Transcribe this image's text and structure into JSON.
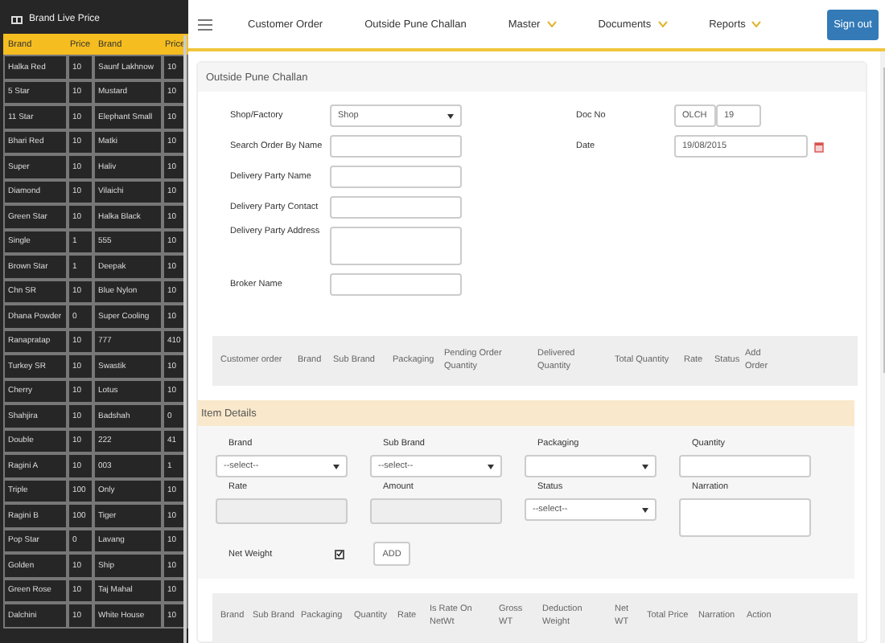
{
  "sidebar": {
    "title": "Brand Live Price",
    "columns": [
      "Brand",
      "Price",
      "Brand",
      "Price"
    ],
    "rows": [
      [
        "Halka Red",
        "10",
        "Saunf Lakhnow",
        "10"
      ],
      [
        "5 Star",
        "10",
        "Mustard",
        "10"
      ],
      [
        "11 Star",
        "10",
        "Elephant Small",
        "10"
      ],
      [
        "Bhari Red",
        "10",
        "Matki",
        "10"
      ],
      [
        "Super",
        "10",
        "Haliv",
        "10"
      ],
      [
        "Diamond",
        "10",
        "Vilaichi",
        "10"
      ],
      [
        "Green Star",
        "10",
        "Halka Black",
        "10"
      ],
      [
        "Single",
        "1",
        "555",
        "10"
      ],
      [
        "Brown Star",
        "1",
        "Deepak",
        "10"
      ],
      [
        "Chn SR",
        "10",
        "Blue Nylon",
        "10"
      ],
      [
        "Dhana Powder",
        "0",
        "Super Cooling",
        "10"
      ],
      [
        "Ranapratap",
        "10",
        "777",
        "410"
      ],
      [
        "Turkey SR",
        "10",
        "Swastik",
        "10"
      ],
      [
        "Cherry",
        "10",
        "Lotus",
        "10"
      ],
      [
        "Shahjira",
        "10",
        "Badshah",
        "0"
      ],
      [
        "Double",
        "10",
        "222",
        "41"
      ],
      [
        "Ragini A",
        "10",
        "003",
        "1"
      ],
      [
        "Triple",
        "100",
        "Only",
        "10"
      ],
      [
        "Ragini B",
        "100",
        "Tiger",
        "10"
      ],
      [
        "Pop Star",
        "0",
        "Lavang",
        "10"
      ],
      [
        "Golden",
        "10",
        "Ship",
        "10"
      ],
      [
        "Green Rose",
        "10",
        "Taj Mahal",
        "10"
      ],
      [
        "Dalchini",
        "10",
        "White House",
        "10"
      ]
    ]
  },
  "nav": {
    "items": [
      {
        "label": "Customer Order",
        "dropdown": false
      },
      {
        "label": "Outside Pune Challan",
        "dropdown": false
      },
      {
        "label": "Master",
        "dropdown": true
      },
      {
        "label": "Documents",
        "dropdown": true
      },
      {
        "label": "Reports",
        "dropdown": true
      }
    ],
    "sign_out": "Sign out"
  },
  "panel": {
    "title": "Outside Pune Challan",
    "fields": [
      {
        "label": "Shop/Factory",
        "kind": "select",
        "value": "Shop"
      },
      {
        "label": "Search Order By Name",
        "kind": "text"
      },
      {
        "label": "Delivery Party Name",
        "kind": "text"
      },
      {
        "label": "Delivery Party Contact",
        "kind": "text"
      },
      {
        "label": "Delivery Party Address",
        "kind": "textarea"
      },
      {
        "label": "Broker Name",
        "kind": "text"
      }
    ],
    "doc_no": {
      "label": "Doc No",
      "prefix": "OLCH",
      "number": "19"
    },
    "date": {
      "label": "Date",
      "value": "19/08/2015"
    }
  },
  "order_table": {
    "columns": [
      "Customer order",
      "Brand",
      "Sub Brand",
      "Packaging",
      "Pending Order Quantity",
      "Delivered Quantity",
      "Total Quantity",
      "Rate",
      "Status",
      "Add Order"
    ]
  },
  "item_details": {
    "title": "Item Details",
    "fields": [
      {
        "label": "Brand",
        "kind": "select",
        "value": "--select--"
      },
      {
        "label": "Sub Brand",
        "kind": "select",
        "value": "--select--"
      },
      {
        "label": "Packaging",
        "kind": "select"
      },
      {
        "label": "Quantity",
        "kind": "text"
      },
      {
        "label": "Rate",
        "kind": "readonly"
      },
      {
        "label": "Amount",
        "kind": "readonly"
      },
      {
        "label": "Status",
        "kind": "select",
        "value": "--select--"
      },
      {
        "label": "Narration",
        "kind": "textarea"
      }
    ],
    "net_weight": {
      "label": "Net Weight",
      "checked": true
    },
    "add_button": "ADD"
  },
  "items_table": {
    "columns": [
      "Brand",
      "Sub Brand",
      "Packaging",
      "Quantity",
      "Rate",
      "Is Rate On NetWt",
      "Gross WT",
      "Deduction Weight",
      "Net WT",
      "Total Price",
      "Narration",
      "Action"
    ]
  }
}
